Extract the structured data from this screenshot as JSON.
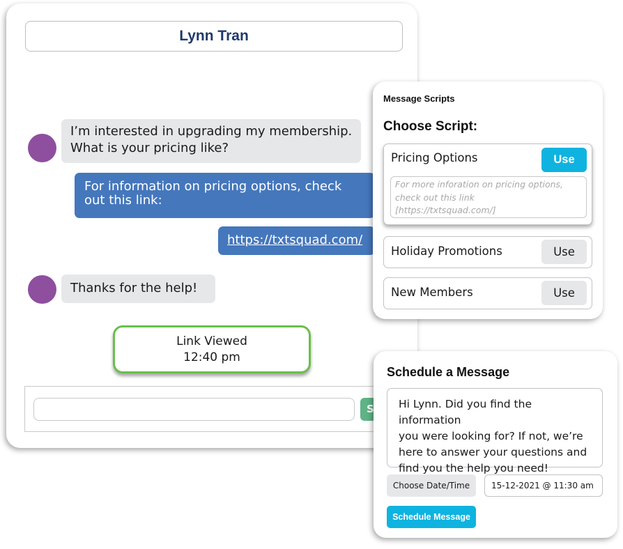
{
  "chat": {
    "contact_name": "Lynn Tran",
    "messages": [
      {
        "direction": "incoming",
        "lines": [
          "I’m interested in upgrading my membership.",
          "What is your pricing like?"
        ]
      },
      {
        "direction": "outgoing",
        "lines": [
          "For information on pricing options, check",
          "out this link:"
        ]
      },
      {
        "direction": "outgoing",
        "link": "https://txtsquad.com/"
      },
      {
        "direction": "incoming",
        "lines": [
          "Thanks for the help!"
        ]
      }
    ],
    "event": {
      "title": "Link Viewed",
      "time": "12:40 pm"
    },
    "composer": {
      "value": "",
      "send_label": "S"
    },
    "colors": {
      "avatar": "#8e4f9e",
      "outgoing": "#4577bc",
      "incoming": "#e6e7e9",
      "event_border": "#6abf4b",
      "send": "#5fb387"
    }
  },
  "scripts": {
    "panel_title": "Message Scripts",
    "heading": "Choose Script:",
    "items": [
      {
        "name": "Pricing Options",
        "use_label": "Use",
        "active": true,
        "preview_lines": [
          "For more inforation on pricing options,",
          "check out this link",
          "[https://txtsquad.com/]"
        ]
      },
      {
        "name": "Holiday Promotions",
        "use_label": "Use",
        "active": false
      },
      {
        "name": "New Members",
        "use_label": "Use",
        "active": false
      }
    ],
    "accent": "#0fb3e0"
  },
  "schedule": {
    "title": "Schedule a Message",
    "message_lines": [
      "Hi Lynn. Did you find the information",
      "you were looking for? If not, we’re",
      "here to answer your questions and",
      "find you the help you need!"
    ],
    "choose_label": "Choose Date/Time",
    "datetime_value": "15-12-2021 @ 11:30 am",
    "submit_label": "Schedule Message"
  }
}
